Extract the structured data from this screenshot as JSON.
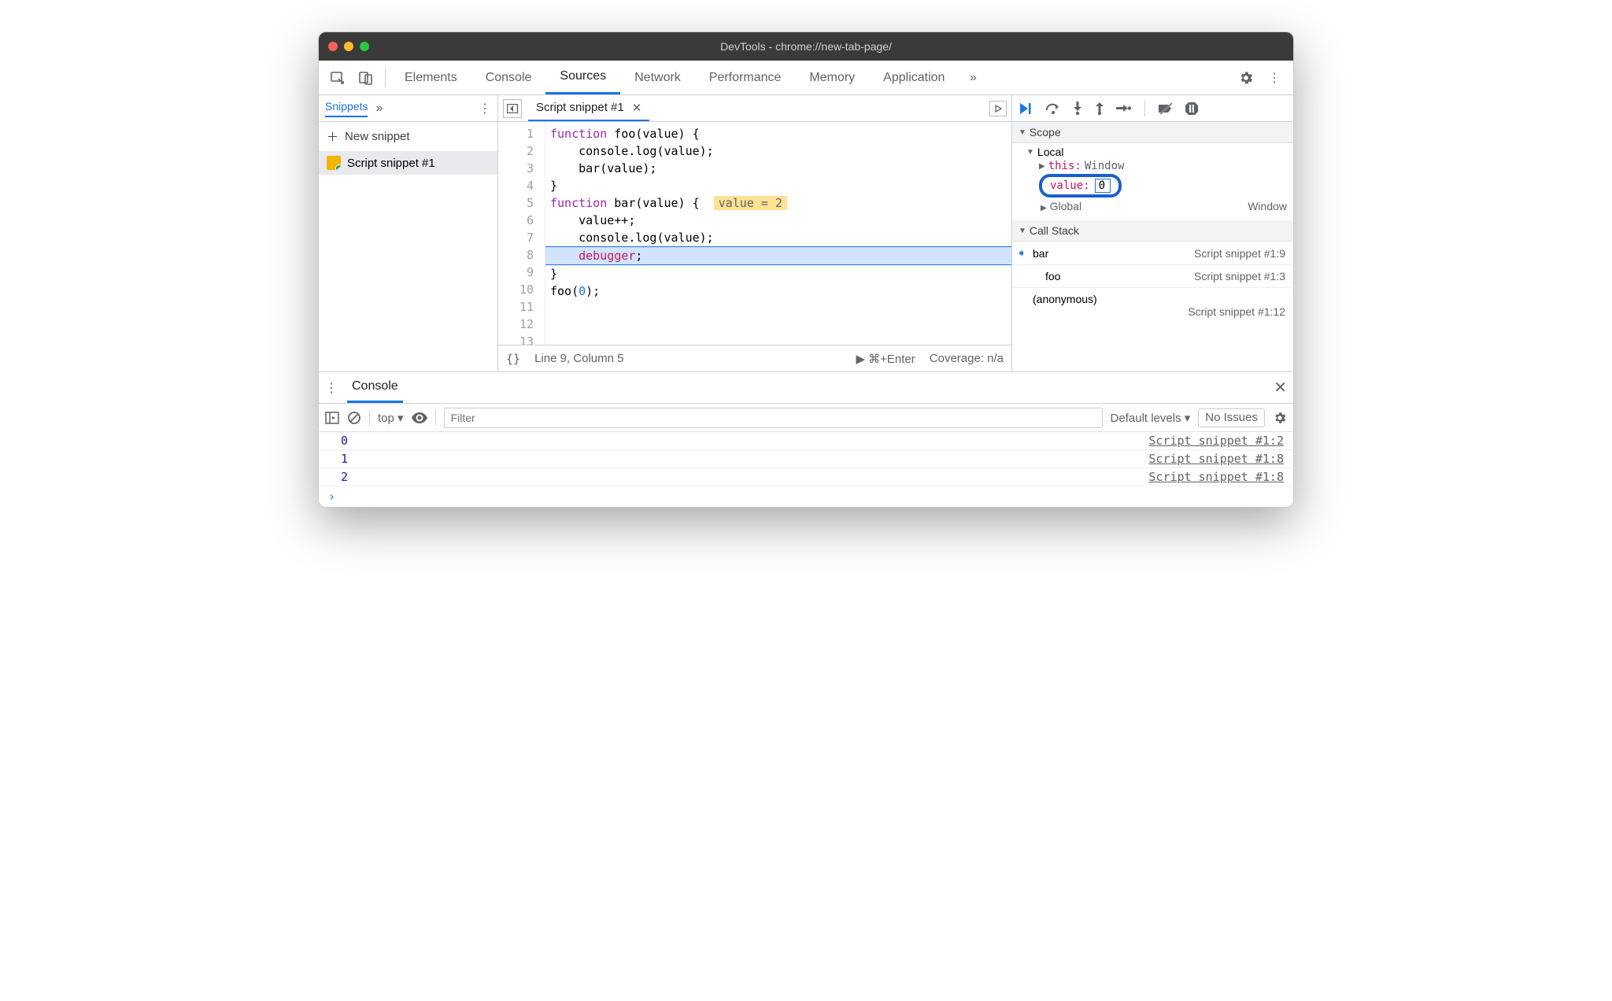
{
  "window": {
    "title": "DevTools - chrome://new-tab-page/"
  },
  "toptabs": {
    "items": [
      "Elements",
      "Console",
      "Sources",
      "Network",
      "Performance",
      "Memory",
      "Application"
    ],
    "active": "Sources"
  },
  "left": {
    "tab": "Snippets",
    "new_label": "New snippet",
    "items": [
      "Script snippet #1"
    ]
  },
  "editor": {
    "filename": "Script snippet #1",
    "inline_hint": "value = 2",
    "lines": {
      "l1a": "function",
      "l1b": " foo(value) {",
      "l2": "    console.log(value);",
      "l3": "    bar(value);",
      "l4": "}",
      "l5": "",
      "l6a": "function",
      "l6b": " bar(value) {  ",
      "l7": "    value++;",
      "l8": "    console.log(value);",
      "l9a": "    ",
      "l9b": "debugger",
      "l9c": ";",
      "l10": "}",
      "l11": "",
      "l12a": "foo(",
      "l12b": "0",
      "l12c": ");",
      "l13": ""
    },
    "status": {
      "braces": "{}",
      "pos": "Line 9, Column 5",
      "run": "▶ ⌘+Enter",
      "coverage": "Coverage: n/a"
    }
  },
  "debugger": {
    "scope_label": "Scope",
    "local_label": "Local",
    "this_label": "this:",
    "this_value": "Window",
    "value_label": "value:",
    "value_edit": "0",
    "global_label": "Global",
    "global_value": "Window",
    "callstack_label": "Call Stack",
    "frames": [
      {
        "name": "bar",
        "loc": "Script snippet #1:9",
        "current": true
      },
      {
        "name": "foo",
        "loc": "Script snippet #1:3",
        "current": false
      }
    ],
    "anon": "(anonymous)",
    "anon_loc": "Script snippet #1:12"
  },
  "drawer": {
    "tab": "Console",
    "context": "top",
    "filter_placeholder": "Filter",
    "levels": "Default levels",
    "issues": "No Issues",
    "lines": [
      {
        "v": "0",
        "src": "Script snippet #1:2"
      },
      {
        "v": "1",
        "src": "Script snippet #1:8"
      },
      {
        "v": "2",
        "src": "Script snippet #1:8"
      }
    ],
    "prompt": "›"
  }
}
